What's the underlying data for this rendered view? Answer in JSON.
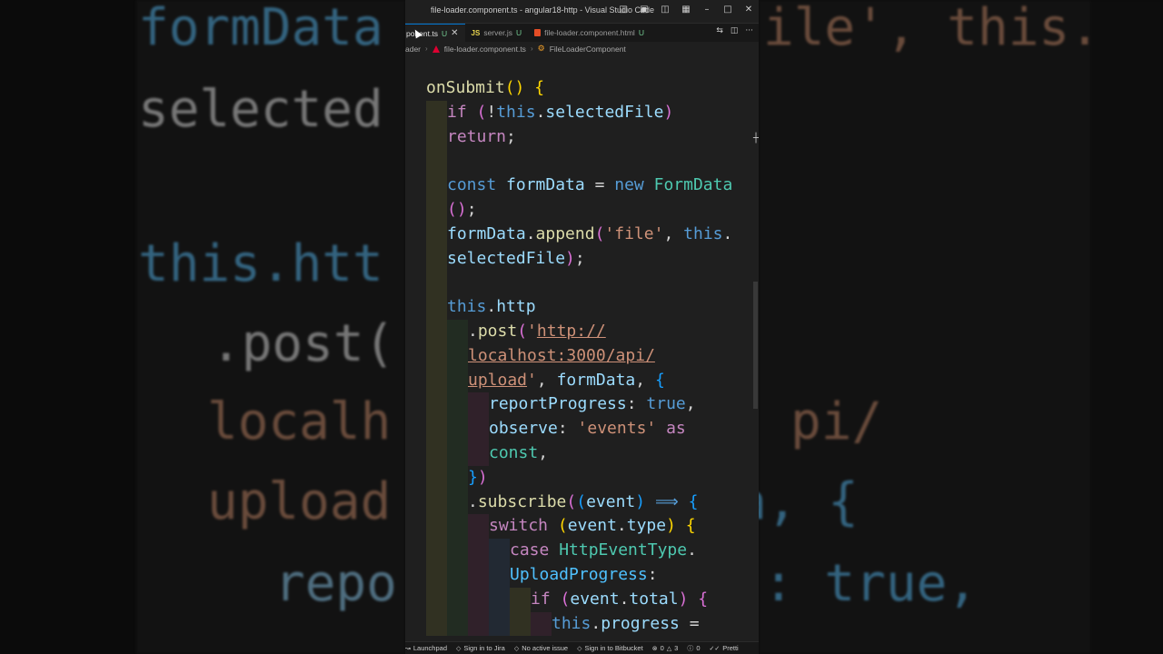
{
  "window": {
    "title": "file-loader.component.ts - angular18-http - Visual Studio Code"
  },
  "tabs": [
    {
      "label": "ponent.ts",
      "status": "U",
      "active": true
    },
    {
      "label": "server.js",
      "status": "U",
      "icon": "JS"
    },
    {
      "label": "file-loader.component.html",
      "status": "U"
    }
  ],
  "breadcrumb": {
    "folder": "ader",
    "file": "file-loader.component.ts",
    "symbol": "FileLoaderComponent"
  },
  "statusbar": {
    "launchpad": "Launchpad",
    "jira": "Sign in to Jira",
    "issue": "No active issue",
    "bitbucket": "Sign in to Bitbucket",
    "errors": "0",
    "warnings": "3",
    "info": "0",
    "prettier": "Pretti"
  },
  "code": {
    "l1_fn": "onSubmit",
    "l2_kw": "if",
    "l2_this": "this",
    "l2_prop": "selectedFile",
    "l3_kw": "return",
    "l5_kw": "const",
    "l5_var": "formData",
    "l5_new": "new",
    "l5_cls": "FormData",
    "l7_var": "formData",
    "l7_fn": "append",
    "l7_str": "'file'",
    "l7_this": "this",
    "l8_prop": "selectedFile",
    "l10_this": "this",
    "l10_prop": "http",
    "l11_fn": "post",
    "l11_url": "http://",
    "l12_url": "localhost:3000/api/",
    "l13_url": "upload",
    "l13_var": "formData",
    "l14_prop": "reportProgress",
    "l14_val": "true",
    "l15_prop": "observe",
    "l15_str": "'events'",
    "l15_kw": "as",
    "l16_kw": "const",
    "l18_fn": "subscribe",
    "l18_var": "event",
    "l19_kw": "switch",
    "l19_var": "event",
    "l19_prop": "type",
    "l20_kw": "case",
    "l20_cls": "HttpEventType",
    "l21_prop": "UploadProgress",
    "l22_kw": "if",
    "l22_var": "event",
    "l22_prop": "total",
    "l23_this": "this",
    "l23_prop": "progress"
  },
  "background": {
    "t1": "formData",
    "t2": "selected",
    "t3": "this.htt",
    "t4": ".post(",
    "t5": "localh",
    "t6": "upload",
    "t7": "repo",
    "t8": "ile', this.",
    "t9": "pi/",
    "t10": "a, {",
    "t11": ": true,"
  }
}
